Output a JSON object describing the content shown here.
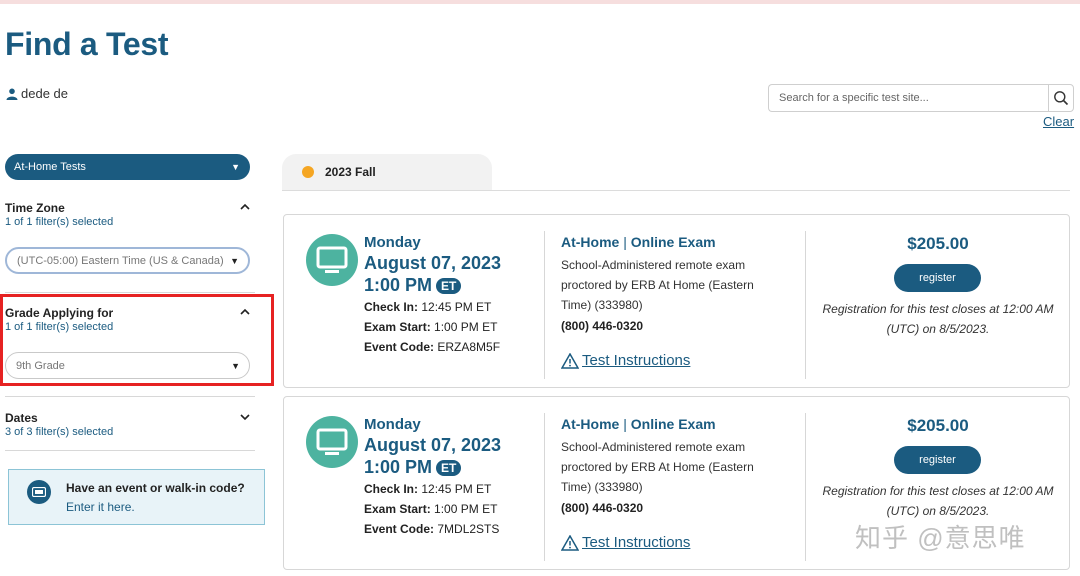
{
  "page": {
    "title": "Find a Test"
  },
  "user": {
    "name": "dede de"
  },
  "search": {
    "placeholder": "Search for a specific test site...",
    "clear_label": "Clear"
  },
  "sidebar": {
    "test_type": "At-Home Tests",
    "filters": [
      {
        "title": "Time Zone",
        "subtitle": "1 of 1 filter(s) selected",
        "value": "(UTC-05:00) Eastern Time (US & Canada)",
        "expanded": true
      },
      {
        "title": "Grade Applying for",
        "subtitle": "1 of 1 filter(s) selected",
        "value": "9th Grade",
        "expanded": true
      },
      {
        "title": "Dates",
        "subtitle": "3 of 3 filter(s) selected",
        "expanded": false
      }
    ],
    "event_box": {
      "title": "Have an event or walk-in code?",
      "link": "Enter it here."
    }
  },
  "tab": {
    "label": "2023 Fall"
  },
  "cards": [
    {
      "day": "Monday",
      "date": "August 07, 2023",
      "time": "1:00 PM",
      "tz": "ET",
      "check_in_label": "Check In:",
      "check_in": "12:45 PM ET",
      "exam_start_label": "Exam Start:",
      "exam_start": "1:00 PM ET",
      "event_code_label": "Event Code:",
      "event_code": "ERZA8M5F",
      "exam_type_a": "At-Home",
      "exam_sep": "|",
      "exam_type_b": "Online Exam",
      "description": "School-Administered remote exam proctored by ERB At Home (Eastern Time) (333980)",
      "phone": "(800) 446-0320",
      "instructions": "Test Instructions",
      "price": "$205.00",
      "register": "register",
      "closes": "Registration for this test closes at 12:00 AM (UTC) on 8/5/2023."
    },
    {
      "day": "Monday",
      "date": "August 07, 2023",
      "time": "1:00 PM",
      "tz": "ET",
      "check_in_label": "Check In:",
      "check_in": "12:45 PM ET",
      "exam_start_label": "Exam Start:",
      "exam_start": "1:00 PM ET",
      "event_code_label": "Event Code:",
      "event_code": "7MDL2STS",
      "exam_type_a": "At-Home",
      "exam_sep": "|",
      "exam_type_b": "Online Exam",
      "description": "School-Administered remote exam proctored by ERB At Home (Eastern Time) (333980)",
      "phone": "(800) 446-0320",
      "instructions": "Test Instructions",
      "price": "$205.00",
      "register": "register",
      "closes": "Registration for this test closes at 12:00 AM (UTC) on 8/5/2023."
    }
  ],
  "watermark": "知乎 @意思唯",
  "colors": {
    "brand": "#1b5b80",
    "teal": "#4db3a0",
    "tab_dot": "#f5a623",
    "highlight": "#e62222"
  }
}
